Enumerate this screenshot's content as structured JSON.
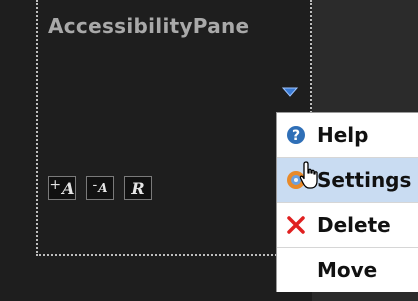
{
  "pane": {
    "title": "AccessibilityPane",
    "buttons": [
      {
        "prefix": "+",
        "glyph": "A"
      },
      {
        "prefix": "-",
        "glyph": "A"
      },
      {
        "prefix": "",
        "glyph": "R"
      }
    ]
  },
  "menu": {
    "items": [
      {
        "label": "Help",
        "icon": "help-icon"
      },
      {
        "label": "Settings",
        "icon": "settings-icon",
        "highlighted": true
      },
      {
        "label": "Delete",
        "icon": "delete-icon"
      },
      {
        "label": "Move",
        "icon": ""
      }
    ]
  },
  "colors": {
    "background": "#1e1e1e",
    "pane_title": "#a9a9a9",
    "menu_highlight": "#c9dcf2",
    "help_icon": "#2f6fb7",
    "delete_icon": "#e02020"
  }
}
